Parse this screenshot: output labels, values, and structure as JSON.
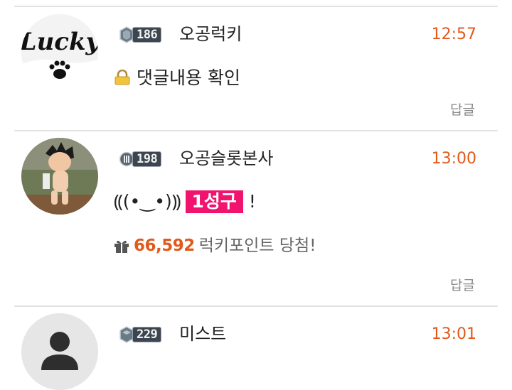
{
  "comments": [
    {
      "avatar_label": "Lucky",
      "level": "186",
      "nickname": "오공럭키",
      "time": "12:57",
      "text": "댓글내용 확인",
      "reply": "답글"
    },
    {
      "level": "198",
      "nickname": "오공슬롯본사",
      "time": "13:00",
      "emote": "⸨(•‿•)⸩",
      "highlight": "1성구",
      "suffix": "!",
      "prize_amount": "66,592",
      "prize_text": "럭키포인트 당첨!",
      "reply": "답글"
    },
    {
      "level": "229",
      "nickname": "미스트",
      "time": "13:01"
    }
  ],
  "colors": {
    "accent": "#e2591b",
    "highlight": "#f0146e",
    "muted": "#8a8a8a",
    "divider": "#e2e2e2"
  }
}
